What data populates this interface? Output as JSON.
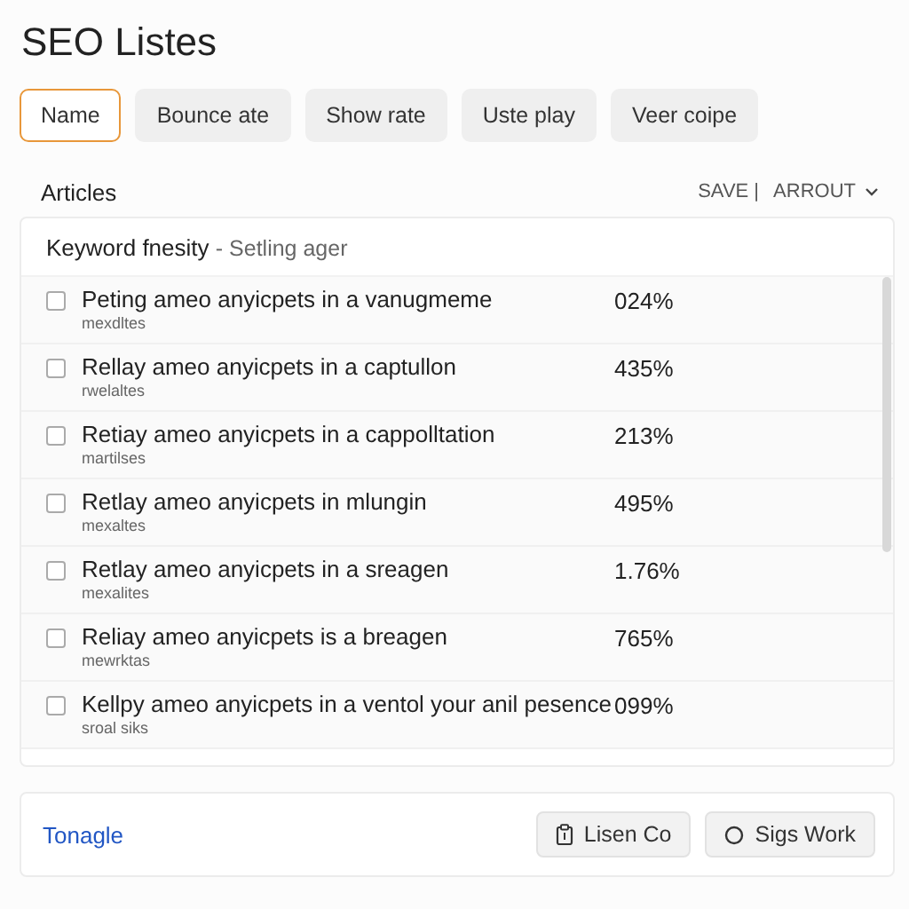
{
  "title": "SEO Listes",
  "tabs": [
    {
      "label": "Name",
      "selected": true
    },
    {
      "label": "Bounce ate",
      "selected": false
    },
    {
      "label": "Show rate",
      "selected": false
    },
    {
      "label": "Uste play",
      "selected": false
    },
    {
      "label": "Veer coipe",
      "selected": false
    }
  ],
  "section": {
    "title": "Articles",
    "save": "SAVE |",
    "sort": "ARROUT"
  },
  "list": {
    "heading": "Keyword fnesity",
    "subheading": "- Setling ager",
    "rows": [
      {
        "title": "Peting ameo anyicpets in a vanugmeme",
        "meta": "mexdltes",
        "value": "024%",
        "checked": false
      },
      {
        "title": "Rellay ameo anyicpets in a captullon",
        "meta": "rwelaltes",
        "value": "435%",
        "checked": false
      },
      {
        "title": "Retiay ameo anyicpets in a cappolltation",
        "meta": "martilses",
        "value": "213%",
        "checked": false
      },
      {
        "title": "Retlay ameo anyicpets in mlungin",
        "meta": "mexaltes",
        "value": "495%",
        "checked": false
      },
      {
        "title": "Retlay ameo anyicpets in a sreagen",
        "meta": "mexalites",
        "value": "1.76%",
        "checked": false
      },
      {
        "title": "Reliay ameo anyicpets is a breagen",
        "meta": "mewrktas",
        "value": "765%",
        "checked": false
      },
      {
        "title": "Kellpy ameo anyicpets in a ventol your anil pesence",
        "meta": "sroal siks",
        "value": "099%",
        "checked": false
      }
    ]
  },
  "footer": {
    "link": "Tonagle",
    "buttons": [
      {
        "label": "Lisen Co",
        "kind": "clipboard"
      },
      {
        "label": "Sigs Work",
        "kind": "circle"
      }
    ]
  }
}
